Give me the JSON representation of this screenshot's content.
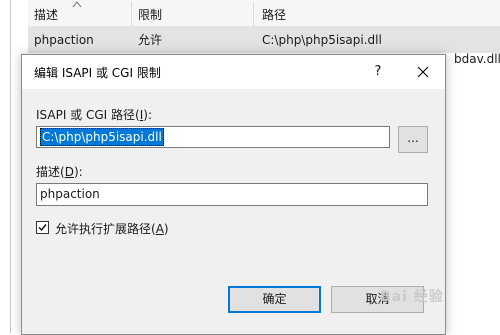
{
  "list": {
    "columns": [
      "描述",
      "限制",
      "路径"
    ],
    "row": {
      "description": "phpaction",
      "restriction": "允许",
      "path": "C:\\php\\php5isapi.dll"
    },
    "clipped_text": "bdav.dll"
  },
  "dialog": {
    "title": "编辑 ISAPI 或 CGI 限制",
    "help_label": "?",
    "path_label_main": "ISAPI 或 CGI 路径(",
    "path_label_key": "I",
    "path_label_end": "):",
    "path_value": "C:\\php\\php5isapi.dll",
    "browse_label": "...",
    "desc_label_main": "描述(",
    "desc_label_key": "D",
    "desc_label_end": "):",
    "desc_value": "phpaction",
    "checkbox_checked": true,
    "checkbox_label_main": "允许执行扩展路径(",
    "checkbox_label_key": "A",
    "checkbox_label_end": ")",
    "ok_label": "确定",
    "cancel_label": "取消"
  },
  "watermark": "Bai 经验"
}
